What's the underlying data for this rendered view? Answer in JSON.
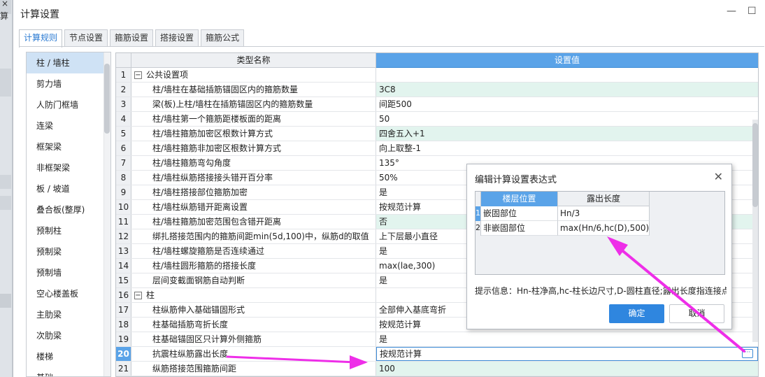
{
  "background_app": {
    "title_fragment": "算",
    "close_glyph": "×"
  },
  "window": {
    "title": "计算设置",
    "minimize_glyph": "—",
    "maximize_glyph": "☐"
  },
  "tabs": [
    {
      "label": "计算规则",
      "active": true
    },
    {
      "label": "节点设置"
    },
    {
      "label": "箍筋设置"
    },
    {
      "label": "搭接设置"
    },
    {
      "label": "箍筋公式"
    }
  ],
  "categories": [
    {
      "label": "柱 / 墙柱",
      "selected": true
    },
    {
      "label": "剪力墙"
    },
    {
      "label": "人防门框墙"
    },
    {
      "label": "连梁"
    },
    {
      "label": "框架梁"
    },
    {
      "label": "非框架梁"
    },
    {
      "label": "板 / 坡道"
    },
    {
      "label": "叠合板(整厚)"
    },
    {
      "label": "预制柱"
    },
    {
      "label": "预制梁"
    },
    {
      "label": "预制墙"
    },
    {
      "label": "空心楼盖板"
    },
    {
      "label": "主肋梁"
    },
    {
      "label": "次肋梁"
    },
    {
      "label": "楼梯"
    },
    {
      "label": "基础"
    }
  ],
  "grid": {
    "col_name": "类型名称",
    "col_value": "设置值",
    "rows": [
      {
        "num": "1",
        "name": "公共设置项",
        "value": "",
        "group": true,
        "toggle": "−"
      },
      {
        "num": "2",
        "name": "柱/墙柱在基础插筋锚固区内的箍筋数量",
        "value": "3C8",
        "green": true
      },
      {
        "num": "3",
        "name": "梁(板)上柱/墙柱在插筋锚固区内的箍筋数量",
        "value": "间距500"
      },
      {
        "num": "4",
        "name": "柱/墙柱第一个箍筋距楼板面的距离",
        "value": "50"
      },
      {
        "num": "5",
        "name": "柱/墙柱箍筋加密区根数计算方式",
        "value": "四舍五入+1",
        "green": true
      },
      {
        "num": "6",
        "name": "柱/墙柱箍筋非加密区根数计算方式",
        "value": "向上取整-1"
      },
      {
        "num": "7",
        "name": "柱/墙柱箍筋弯勾角度",
        "value": "135°"
      },
      {
        "num": "8",
        "name": "柱/墙柱纵筋搭接接头错开百分率",
        "value": "50%"
      },
      {
        "num": "9",
        "name": "柱/墙柱搭接部位箍筋加密",
        "value": "是"
      },
      {
        "num": "10",
        "name": "柱/墙柱纵筋错开距离设置",
        "value": "按规范计算"
      },
      {
        "num": "11",
        "name": "柱/墙柱箍筋加密范围包含错开距离",
        "value": "否",
        "green": true
      },
      {
        "num": "12",
        "name": "绑扎搭接范围内的箍筋间距min(5d,100)中，纵筋d的取值",
        "value": "上下层最小直径"
      },
      {
        "num": "13",
        "name": "柱/墙柱螺旋箍筋是否连续通过",
        "value": "是"
      },
      {
        "num": "14",
        "name": "柱/墙柱圆形箍筋的搭接长度",
        "value": "max(lae,300)"
      },
      {
        "num": "15",
        "name": "层间变截面钢筋自动判断",
        "value": "是"
      },
      {
        "num": "16",
        "name": "柱",
        "value": "",
        "group": true,
        "toggle": "−"
      },
      {
        "num": "17",
        "name": "柱纵筋伸入基础锚固形式",
        "value": "全部伸入基底弯折"
      },
      {
        "num": "18",
        "name": "柱基础插筋弯折长度",
        "value": "按规范计算"
      },
      {
        "num": "19",
        "name": "柱基础锚固区只计算外侧箍筋",
        "value": "是"
      },
      {
        "num": "20",
        "name": "抗震柱纵筋露出长度",
        "value": "按规范计算",
        "selected": true,
        "ellipsis": "···"
      },
      {
        "num": "21",
        "name": "纵筋搭接范围箍筋间距",
        "value": "100",
        "green": true
      }
    ]
  },
  "popup": {
    "title": "编辑计算设置表达式",
    "close_glyph": "✕",
    "col1": "楼层位置",
    "col2": "露出长度",
    "rows": [
      {
        "num": "1",
        "position": "嵌固部位",
        "length": "Hn/3"
      },
      {
        "num": "2",
        "position": "非嵌固部位",
        "length": "max(Hn/6,hc(D),500)"
      }
    ],
    "hint": "提示信息：Hn-柱净高,hc-柱长边尺寸,D-圆柱直径;露出长度指连接点",
    "ok_label": "确定",
    "cancel_label": "取消"
  },
  "colors": {
    "accent": "#2f86df",
    "header_blue": "#5aa3e8",
    "green_row": "#e2f4ee",
    "arrow": "#ee2ee8"
  }
}
